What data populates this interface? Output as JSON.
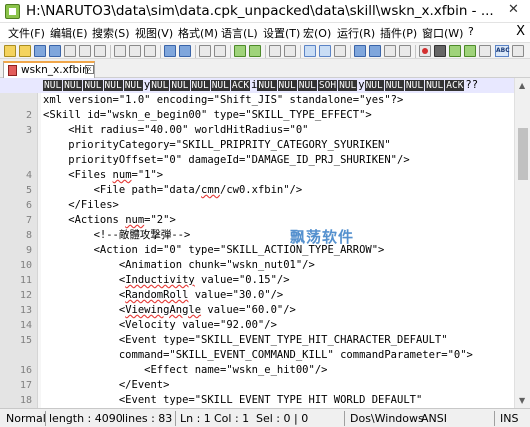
{
  "window": {
    "title": "H:\\NARUTO3\\data\\sim\\data.cpk_unpacked\\data\\skill\\wskn_x.xfbin - ...",
    "minimize_glyph": "—",
    "restore_glyph": "❐",
    "close_glyph": "✕"
  },
  "menu": {
    "items": [
      "文件(F)",
      "编辑(E)",
      "搜索(S)",
      "视图(V)",
      "格式(M)",
      "语言(L)",
      "设置(T)",
      "宏(O)",
      "运行(R)",
      "插件(P)",
      "窗口(W)",
      "?"
    ],
    "close_glyph": "X"
  },
  "tab": {
    "label": "wskn_x.xfbin",
    "close_glyph": "x"
  },
  "editor": {
    "lines": [
      {
        "ln": "",
        "segments": [
          {
            "t": "nul",
            "text": "NUL"
          },
          {
            "t": "nul",
            "text": "NUL"
          },
          {
            "t": "nul",
            "text": "NUL"
          },
          {
            "t": "nul",
            "text": "NUL"
          },
          {
            "t": "nul",
            "text": "NUL"
          },
          {
            "t": "plain",
            "text": "y"
          },
          {
            "t": "nul",
            "text": "NUL"
          },
          {
            "t": "nul",
            "text": "NUL"
          },
          {
            "t": "nul",
            "text": "NUL"
          },
          {
            "t": "nul",
            "text": "NUL"
          },
          {
            "t": "nul",
            "text": "ACK"
          },
          {
            "t": "plain",
            "text": "i"
          },
          {
            "t": "nul",
            "text": "NUL"
          },
          {
            "t": "nul",
            "text": "NUL"
          },
          {
            "t": "nul",
            "text": "NUL"
          },
          {
            "t": "nul",
            "text": "SOH"
          },
          {
            "t": "nul",
            "text": "NUL"
          },
          {
            "t": "plain",
            "text": "y"
          },
          {
            "t": "nul",
            "text": "NUL"
          },
          {
            "t": "nul",
            "text": "NUL"
          },
          {
            "t": "nul",
            "text": "NUL"
          },
          {
            "t": "nul",
            "text": "NUL"
          },
          {
            "t": "nul",
            "text": "ACK"
          },
          {
            "t": "plain",
            "text": "??"
          }
        ],
        "current": true
      },
      {
        "ln": "",
        "text": "xml version=\"1.0\" encoding=\"Shift_JIS\" standalone=\"yes\"?>"
      },
      {
        "ln": "2",
        "text": "<Skill id=\"wskn_e_begin00\" type=\"SKILL_TYPE_EFFECT\">"
      },
      {
        "ln": "3",
        "text": "    <Hit radius=\"40.00\" worldHitRadius=\"0\""
      },
      {
        "ln": "",
        "text": "    priorityCategory=\"SKILL_PRIPRITY_CATEGORY_SYURIKEN\""
      },
      {
        "ln": "",
        "text": "    priorityOffset=\"0\" damageId=\"DAMAGE_ID_PRJ_SHURIKEN\"/>"
      },
      {
        "ln": "4",
        "text": "    <Files num=\"1\">",
        "squiggle": "num"
      },
      {
        "ln": "5",
        "text": "        <File path=\"data/cmn/cw0.xfbin\"/>",
        "squiggle": "cmn"
      },
      {
        "ln": "6",
        "text": "    </Files>"
      },
      {
        "ln": "7",
        "text": "    <Actions num=\"2\">",
        "squiggle": "num"
      },
      {
        "ln": "8",
        "text": "        <!--敵體攻撃弾-->"
      },
      {
        "ln": "9",
        "text": "        <Action id=\"0\" type=\"SKILL_ACTION_TYPE_ARROW\">"
      },
      {
        "ln": "10",
        "text": "            <Animation chunk=\"wskn_nut01\"/>"
      },
      {
        "ln": "11",
        "text": "            <Inductivity value=\"0.15\"/>",
        "squiggle": "Inductivity"
      },
      {
        "ln": "12",
        "text": "            <RandomRoll value=\"30.0\"/>",
        "squiggle": "RandomRoll"
      },
      {
        "ln": "13",
        "text": "            <ViewingAngle value=\"60.0\"/>",
        "squiggle": "ViewingAngle"
      },
      {
        "ln": "14",
        "text": "            <Velocity value=\"92.00\"/>"
      },
      {
        "ln": "15",
        "text": "            <Event type=\"SKILL_EVENT_TYPE_HIT_CHARACTER_DEFAULT\""
      },
      {
        "ln": "",
        "text": "            command=\"SKILL_EVENT_COMMAND_KILL\" commandParameter=\"0\">"
      },
      {
        "ln": "16",
        "text": "                <Effect name=\"wskn_e_hit00\"/>"
      },
      {
        "ln": "17",
        "text": "            </Event>"
      },
      {
        "ln": "18",
        "text": "            <Event type=\"SKILL EVENT TYPE HIT WORLD DEFAULT\""
      }
    ]
  },
  "watermark": "飘荡软件",
  "status": {
    "mode": "Normal",
    "length": "length : 4090",
    "lines": "lines : 83",
    "ln": "Ln : 1",
    "col": "Col : 1",
    "sel": "Sel : 0 | 0",
    "eol": "Dos\\Windows",
    "encoding": "ANSI",
    "ins": "INS"
  }
}
